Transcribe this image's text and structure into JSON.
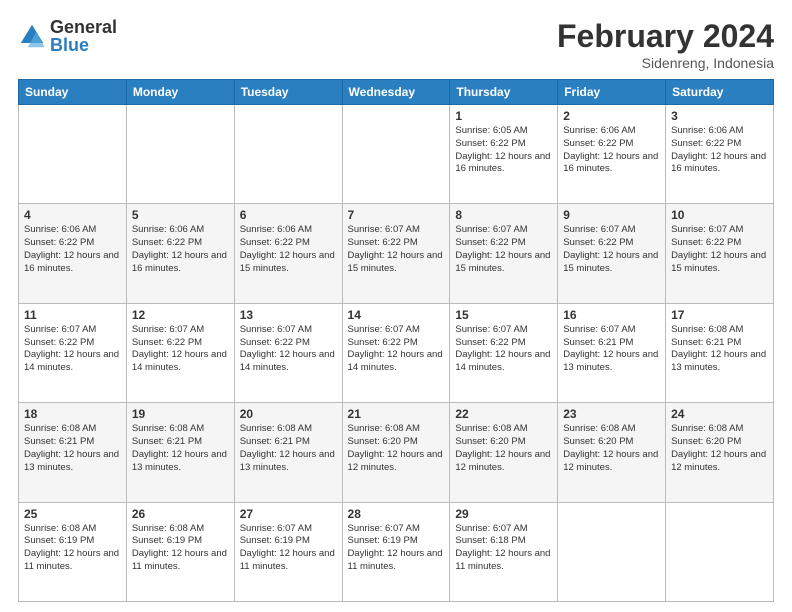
{
  "header": {
    "logo_general": "General",
    "logo_blue": "Blue",
    "month_title": "February 2024",
    "subtitle": "Sidenreng, Indonesia"
  },
  "days_of_week": [
    "Sunday",
    "Monday",
    "Tuesday",
    "Wednesday",
    "Thursday",
    "Friday",
    "Saturday"
  ],
  "weeks": [
    [
      {
        "day": "",
        "info": ""
      },
      {
        "day": "",
        "info": ""
      },
      {
        "day": "",
        "info": ""
      },
      {
        "day": "",
        "info": ""
      },
      {
        "day": "1",
        "info": "Sunrise: 6:05 AM\nSunset: 6:22 PM\nDaylight: 12 hours and 16 minutes."
      },
      {
        "day": "2",
        "info": "Sunrise: 6:06 AM\nSunset: 6:22 PM\nDaylight: 12 hours and 16 minutes."
      },
      {
        "day": "3",
        "info": "Sunrise: 6:06 AM\nSunset: 6:22 PM\nDaylight: 12 hours and 16 minutes."
      }
    ],
    [
      {
        "day": "4",
        "info": "Sunrise: 6:06 AM\nSunset: 6:22 PM\nDaylight: 12 hours and 16 minutes."
      },
      {
        "day": "5",
        "info": "Sunrise: 6:06 AM\nSunset: 6:22 PM\nDaylight: 12 hours and 16 minutes."
      },
      {
        "day": "6",
        "info": "Sunrise: 6:06 AM\nSunset: 6:22 PM\nDaylight: 12 hours and 15 minutes."
      },
      {
        "day": "7",
        "info": "Sunrise: 6:07 AM\nSunset: 6:22 PM\nDaylight: 12 hours and 15 minutes."
      },
      {
        "day": "8",
        "info": "Sunrise: 6:07 AM\nSunset: 6:22 PM\nDaylight: 12 hours and 15 minutes."
      },
      {
        "day": "9",
        "info": "Sunrise: 6:07 AM\nSunset: 6:22 PM\nDaylight: 12 hours and 15 minutes."
      },
      {
        "day": "10",
        "info": "Sunrise: 6:07 AM\nSunset: 6:22 PM\nDaylight: 12 hours and 15 minutes."
      }
    ],
    [
      {
        "day": "11",
        "info": "Sunrise: 6:07 AM\nSunset: 6:22 PM\nDaylight: 12 hours and 14 minutes."
      },
      {
        "day": "12",
        "info": "Sunrise: 6:07 AM\nSunset: 6:22 PM\nDaylight: 12 hours and 14 minutes."
      },
      {
        "day": "13",
        "info": "Sunrise: 6:07 AM\nSunset: 6:22 PM\nDaylight: 12 hours and 14 minutes."
      },
      {
        "day": "14",
        "info": "Sunrise: 6:07 AM\nSunset: 6:22 PM\nDaylight: 12 hours and 14 minutes."
      },
      {
        "day": "15",
        "info": "Sunrise: 6:07 AM\nSunset: 6:22 PM\nDaylight: 12 hours and 14 minutes."
      },
      {
        "day": "16",
        "info": "Sunrise: 6:07 AM\nSunset: 6:21 PM\nDaylight: 12 hours and 13 minutes."
      },
      {
        "day": "17",
        "info": "Sunrise: 6:08 AM\nSunset: 6:21 PM\nDaylight: 12 hours and 13 minutes."
      }
    ],
    [
      {
        "day": "18",
        "info": "Sunrise: 6:08 AM\nSunset: 6:21 PM\nDaylight: 12 hours and 13 minutes."
      },
      {
        "day": "19",
        "info": "Sunrise: 6:08 AM\nSunset: 6:21 PM\nDaylight: 12 hours and 13 minutes."
      },
      {
        "day": "20",
        "info": "Sunrise: 6:08 AM\nSunset: 6:21 PM\nDaylight: 12 hours and 13 minutes."
      },
      {
        "day": "21",
        "info": "Sunrise: 6:08 AM\nSunset: 6:20 PM\nDaylight: 12 hours and 12 minutes."
      },
      {
        "day": "22",
        "info": "Sunrise: 6:08 AM\nSunset: 6:20 PM\nDaylight: 12 hours and 12 minutes."
      },
      {
        "day": "23",
        "info": "Sunrise: 6:08 AM\nSunset: 6:20 PM\nDaylight: 12 hours and 12 minutes."
      },
      {
        "day": "24",
        "info": "Sunrise: 6:08 AM\nSunset: 6:20 PM\nDaylight: 12 hours and 12 minutes."
      }
    ],
    [
      {
        "day": "25",
        "info": "Sunrise: 6:08 AM\nSunset: 6:19 PM\nDaylight: 12 hours and 11 minutes."
      },
      {
        "day": "26",
        "info": "Sunrise: 6:08 AM\nSunset: 6:19 PM\nDaylight: 12 hours and 11 minutes."
      },
      {
        "day": "27",
        "info": "Sunrise: 6:07 AM\nSunset: 6:19 PM\nDaylight: 12 hours and 11 minutes."
      },
      {
        "day": "28",
        "info": "Sunrise: 6:07 AM\nSunset: 6:19 PM\nDaylight: 12 hours and 11 minutes."
      },
      {
        "day": "29",
        "info": "Sunrise: 6:07 AM\nSunset: 6:18 PM\nDaylight: 12 hours and 11 minutes."
      },
      {
        "day": "",
        "info": ""
      },
      {
        "day": "",
        "info": ""
      }
    ]
  ]
}
